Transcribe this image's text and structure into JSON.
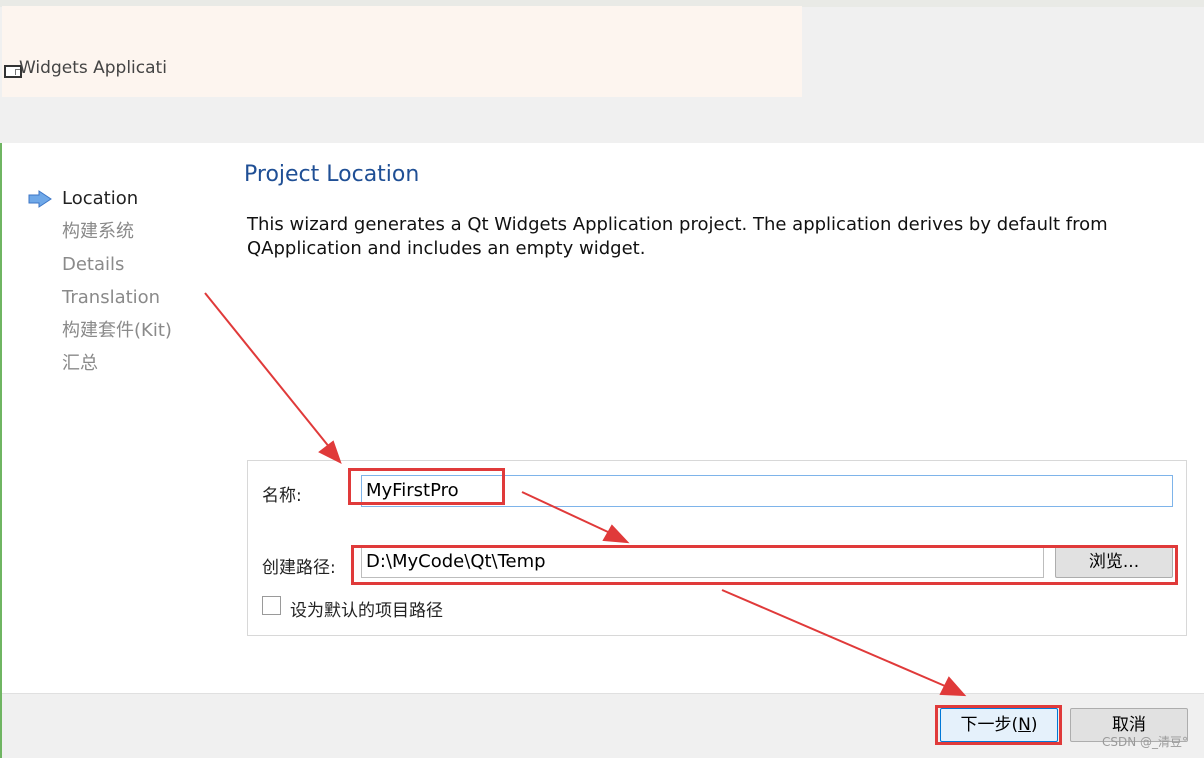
{
  "window": {
    "title": "Widgets Applicati"
  },
  "sidebar": {
    "items": [
      {
        "label": "Location",
        "current": true
      },
      {
        "label": "构建系统",
        "current": false
      },
      {
        "label": "Details",
        "current": false
      },
      {
        "label": "Translation",
        "current": false
      },
      {
        "label": "构建套件(Kit)",
        "current": false
      },
      {
        "label": "汇总",
        "current": false
      }
    ]
  },
  "page": {
    "title": "Project Location",
    "description": "This wizard generates a Qt Widgets Application project. The application derives by default from QApplication and includes an empty widget."
  },
  "form": {
    "name_label": "名称:",
    "name_value": "MyFirstPro",
    "path_label": "创建路径:",
    "path_value": "D:\\MyCode\\Qt\\Temp",
    "browse_label": "浏览...",
    "default_checkbox_label": "设为默认的项目路径",
    "default_checked": false
  },
  "footer": {
    "next_label_prefix": "下一步(",
    "next_mnemonic": "N",
    "next_label_suffix": ")",
    "cancel_label": "取消"
  },
  "watermark": "CSDN @_清豆°",
  "colors": {
    "accent": "#1f4f95",
    "annotation": "#e03a3a",
    "focus_border": "#0078d7"
  }
}
